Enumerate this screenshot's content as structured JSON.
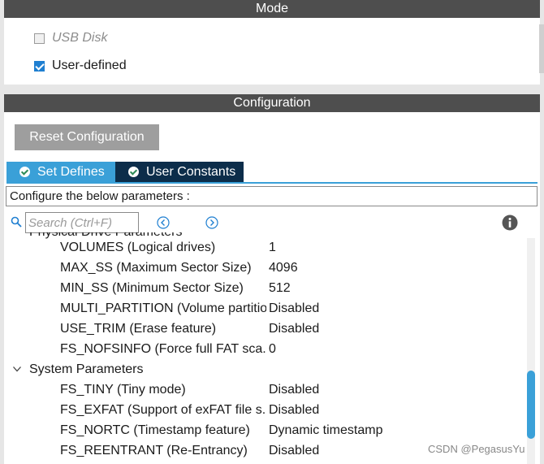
{
  "mode": {
    "title": "Mode",
    "usb_disk_label": "USB Disk",
    "user_defined_label": "User-defined"
  },
  "configuration": {
    "title": "Configuration",
    "reset_label": "Reset Configuration",
    "tabs": [
      {
        "label": "Set Defines"
      },
      {
        "label": "User Constants"
      }
    ],
    "configure_text": "Configure the below parameters :",
    "search_placeholder": "Search (Ctrl+F)"
  },
  "tree": {
    "group_physical": "Physical Drive Parameters",
    "physical_params": [
      {
        "name": "VOLUMES (Logical drives)",
        "value": "1"
      },
      {
        "name": "MAX_SS (Maximum Sector Size)",
        "value": "4096"
      },
      {
        "name": "MIN_SS (Minimum Sector Size)",
        "value": "512"
      },
      {
        "name": "MULTI_PARTITION (Volume partitio..",
        "value": "Disabled"
      },
      {
        "name": "USE_TRIM (Erase feature)",
        "value": "Disabled"
      },
      {
        "name": "FS_NOFSINFO (Force full FAT sca..",
        "value": "0"
      }
    ],
    "group_system": "System Parameters",
    "system_params": [
      {
        "name": "FS_TINY (Tiny mode)",
        "value": "Disabled"
      },
      {
        "name": "FS_EXFAT (Support of exFAT file s..",
        "value": "Disabled"
      },
      {
        "name": "FS_NORTC (Timestamp feature)",
        "value": "Dynamic timestamp"
      },
      {
        "name": "FS_REENTRANT (Re-Entrancy)",
        "value": "Disabled"
      }
    ]
  },
  "watermark": "CSDN @PegasusYu",
  "colors": {
    "header_bg": "#4e4e4e",
    "tab_active": "#3aa0d8",
    "tab_inactive": "#0c2d4a",
    "checkbox_checked": "#1f7fd1"
  }
}
